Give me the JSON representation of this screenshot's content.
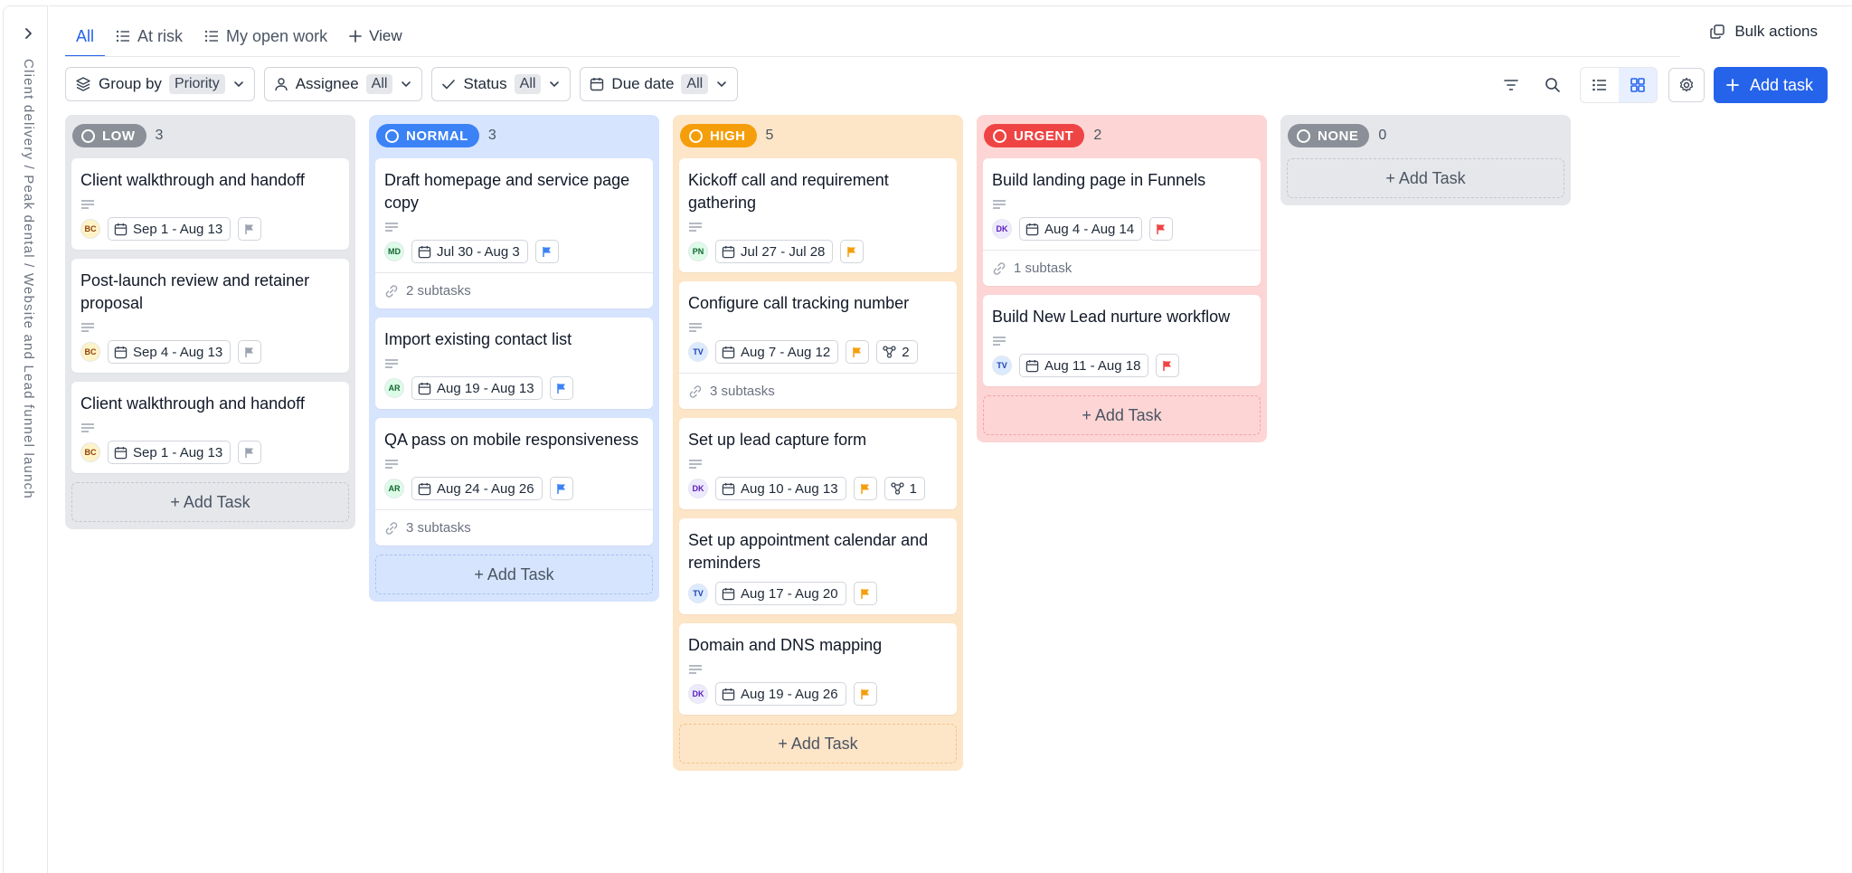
{
  "breadcrumb": "Client delivery / Peak dental / Website and Lead funnel launch",
  "tabs": [
    {
      "label": "All",
      "active": true
    },
    {
      "label": "At risk"
    },
    {
      "label": "My open work"
    },
    {
      "label": "View"
    }
  ],
  "bulk_actions_label": "Bulk actions",
  "filters": {
    "group_by": {
      "label": "Group by",
      "value": "Priority"
    },
    "assignee": {
      "label": "Assignee",
      "value": "All"
    },
    "status": {
      "label": "Status",
      "value": "All"
    },
    "due_date": {
      "label": "Due date",
      "value": "All"
    }
  },
  "add_task_label": "Add task",
  "add_task_column_label": "+ Add Task",
  "colors": {
    "accent": "#2563eb",
    "low": "#8a8f98",
    "normal": "#3b82f6",
    "high": "#f59e0b",
    "urgent": "#ef4444",
    "none": "#8a8f98"
  },
  "columns": {
    "low": {
      "label": "LOW",
      "count": "3",
      "cards": [
        {
          "title": "Client walkthrough and handoff",
          "avatar": "BC",
          "date": "Sep 1 - Aug 13",
          "flag": "gray"
        },
        {
          "title": "Post-launch review and retainer proposal",
          "avatar": "BC",
          "date": "Sep 4 - Aug 13",
          "flag": "gray"
        },
        {
          "title": "Client walkthrough and handoff",
          "avatar": "BC",
          "date": "Sep 1 - Aug 13",
          "flag": "gray"
        }
      ]
    },
    "normal": {
      "label": "NORMAL",
      "count": "3",
      "cards": [
        {
          "title": "Draft homepage and service page copy",
          "avatar": "MD",
          "date": "Jul 30 - Aug 3",
          "flag": "blue",
          "subtasks": "2 subtasks"
        },
        {
          "title": "Import existing contact list",
          "avatar": "AR",
          "date": "Aug 19 - Aug 13",
          "flag": "blue"
        },
        {
          "title": "QA pass on mobile responsiveness",
          "avatar": "AR",
          "date": "Aug 24 - Aug 26",
          "flag": "blue",
          "subtasks": "3 subtasks"
        }
      ]
    },
    "high": {
      "label": "HIGH",
      "count": "5",
      "cards": [
        {
          "title": "Kickoff call and requirement gathering",
          "avatar": "PN",
          "date": "Jul 27 - Jul 28",
          "flag": "orange"
        },
        {
          "title": "Configure call tracking number",
          "avatar": "TV",
          "date": "Aug 7 - Aug 12",
          "flag": "orange",
          "deps": "2",
          "subtasks": "3 subtasks"
        },
        {
          "title": "Set up lead capture form",
          "avatar": "DK",
          "date": "Aug 10 - Aug 13",
          "flag": "orange",
          "deps": "1"
        },
        {
          "title": "Set up appointment calendar and reminders",
          "avatar": "TV",
          "date": "Aug 17 - Aug 20",
          "flag": "orange"
        },
        {
          "title": "Domain and DNS mapping",
          "avatar": "DK",
          "date": "Aug 19 - Aug 26",
          "flag": "orange"
        }
      ]
    },
    "urgent": {
      "label": "URGENT",
      "count": "2",
      "cards": [
        {
          "title": "Build landing page in Funnels",
          "avatar": "DK",
          "date": "Aug 4 - Aug 14",
          "flag": "red",
          "subtasks": "1 subtask"
        },
        {
          "title": "Build New Lead nurture workflow",
          "avatar": "TV",
          "date": "Aug 11 - Aug 18",
          "flag": "red"
        }
      ]
    },
    "none": {
      "label": "NONE",
      "count": "0",
      "cards": []
    }
  }
}
